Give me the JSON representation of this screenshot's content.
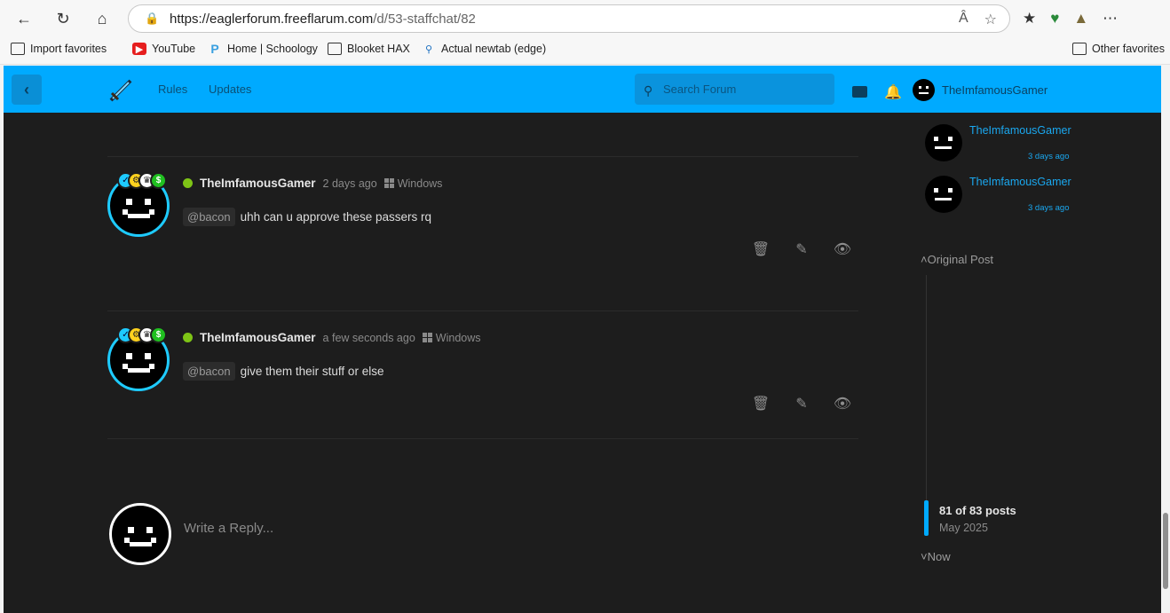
{
  "browser": {
    "url_host": "https://eaglerforum.freeflarum.com",
    "url_path": "/d/53-staffchat/82",
    "bookmarks": [
      {
        "label": "Import favorites",
        "icon": "import-icon"
      },
      {
        "label": "YouTube",
        "icon": "youtube-icon"
      },
      {
        "label": "Home | Schoology",
        "icon": "schoology-icon"
      },
      {
        "label": "Blooket HAX",
        "icon": "folder-icon"
      },
      {
        "label": "Actual newtab (edge)",
        "icon": "search-icon"
      },
      {
        "label": "Other favorites",
        "icon": "folder-icon"
      }
    ]
  },
  "forum": {
    "nav_links": [
      "Rules",
      "Updates"
    ],
    "search_placeholder": "Search Forum",
    "current_user": "TheImfamousGamer",
    "brand_color": "#00aaff"
  },
  "posts": [
    {
      "author": "TheImfamousGamer",
      "time": "2 days ago",
      "os": "Windows",
      "mention": "@bacon",
      "text": "uhh can u approve these passers rq"
    },
    {
      "author": "TheImfamousGamer",
      "time": "a few seconds ago",
      "os": "Windows",
      "mention": "@bacon",
      "text": "give them their stuff or else"
    }
  ],
  "reply": {
    "placeholder": "Write a Reply..."
  },
  "sidebar": {
    "recent": [
      {
        "name": "TheImfamousGamer",
        "time": "3 days ago"
      },
      {
        "name": "TheImfamousGamer",
        "time": "3 days ago"
      }
    ],
    "original_post_label": "Original Post",
    "position_label": "81 of 83 posts",
    "date_label": "May 2025",
    "now_label": "Now"
  }
}
